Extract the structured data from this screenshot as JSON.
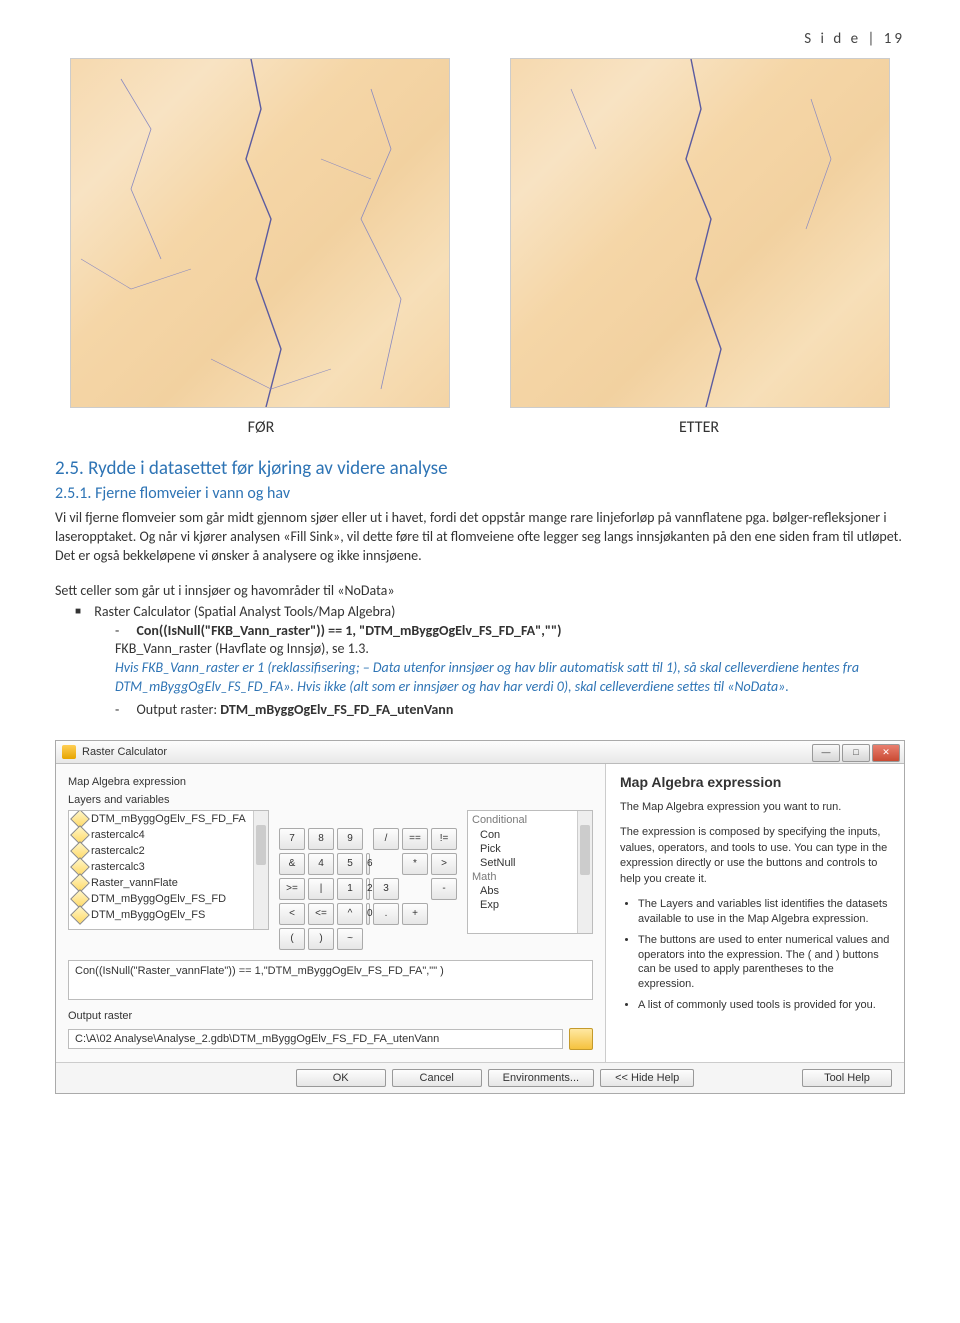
{
  "header": {
    "page_label": "S i d e  | 19"
  },
  "maps": {
    "before_label": "FØR",
    "after_label": "ETTER"
  },
  "section": {
    "heading": "2.5. Rydde i datasettet før kjøring av videre analyse",
    "subsection": "2.5.1. Fjerne flomveier i vann og hav",
    "para1": "Vi vil fjerne flomveier som går midt gjennom sjøer eller ut i havet, fordi det oppstår mange rare linjeforløp på vannflatene pga. bølger-refleksjoner i laseropptaket. Og når vi kjører analysen «Fill Sink», vil dette føre til at flomveiene ofte legger seg langs innsjøkanten på den ene siden fram til utløpet. Det er også bekkeløpene vi ønsker å analysere og ikke innsjøene.",
    "para2_lead": "Sett celler som går ut i innsjøer og havområder til «NoData»",
    "bullet1": "Raster Calculator (Spatial Analyst Tools/Map Algebra)",
    "dash1_expr": "Con((IsNull(\"FKB_Vann_raster\")) == 1, \"DTM_mByggOgElv_FS_FD_FA\",\"\")",
    "dash1_line2_a": "FKB_Vann_raster (Havflate og Innsjø), se 1.3.",
    "dash1_line3_a": "Hvis FKB_Vann_raster er 1 ",
    "dash1_line3_b": "(reklassifisering; – Data utenfor innsjøer og hav blir automatisk satt til 1)",
    "dash1_line3_c": ", så skal celleverdiene hentes fra DTM_mByggOgElv_FS_FD_FA». Hvis ikke ",
    "dash1_line3_d": "(alt som er innsjøer og hav har verdi 0)",
    "dash1_line3_e": ", skal celleverdiene settes til «NoData».",
    "dash2_label": "Output raster: ",
    "dash2_value": "DTM_mByggOgElv_FS_FD_FA_utenVann"
  },
  "dialog": {
    "title": "Raster Calculator",
    "left": {
      "expr_label": "Map Algebra expression",
      "layers_label": "Layers and variables",
      "layers": [
        "DTM_mByggOgElv_FS_FD_FA",
        "rastercalc4",
        "rastercalc2",
        "rastercalc3",
        "Raster_vannFlate",
        "DTM_mByggOgElv_FS_FD",
        "DTM_mByggOgElv_FS"
      ],
      "keypad": [
        "7",
        "8",
        "9",
        "/",
        "==",
        "!=",
        "&",
        "4",
        "5",
        "6",
        "*",
        ">",
        ">=",
        "|",
        "1",
        "2",
        "3",
        "-",
        "<",
        "<=",
        "^",
        "0",
        ".",
        "+",
        "(",
        ")",
        "~"
      ],
      "tools_header1": "Conditional",
      "tools1": [
        "Con",
        "Pick",
        "SetNull"
      ],
      "tools_header2": "Math",
      "tools2": [
        "Abs",
        "Exp"
      ],
      "expression": "Con((IsNull(\"Raster_vannFlate\")) == 1,\"DTM_mByggOgElv_FS_FD_FA\",\"\" )",
      "output_label": "Output raster",
      "output_value": "C:\\A\\02 Analyse\\Analyse_2.gdb\\DTM_mByggOgElv_FS_FD_FA_utenVann"
    },
    "right": {
      "title": "Map Algebra expression",
      "p1": "The Map Algebra expression you want to run.",
      "p2": "The expression is composed by specifying the inputs, values, operators, and tools to use. You can type in the expression directly or use the buttons and controls to help you create it.",
      "li1": "The Layers and variables list identifies the datasets available to use in the Map Algebra expression.",
      "li2": "The buttons are used to enter numerical values and operators into the expression. The ( and ) buttons can be used to apply parentheses to the expression.",
      "li3": "A list of commonly used tools is provided for you."
    },
    "footer": {
      "ok": "OK",
      "cancel": "Cancel",
      "env": "Environments...",
      "hide": "<< Hide Help",
      "toolhelp": "Tool Help"
    }
  }
}
